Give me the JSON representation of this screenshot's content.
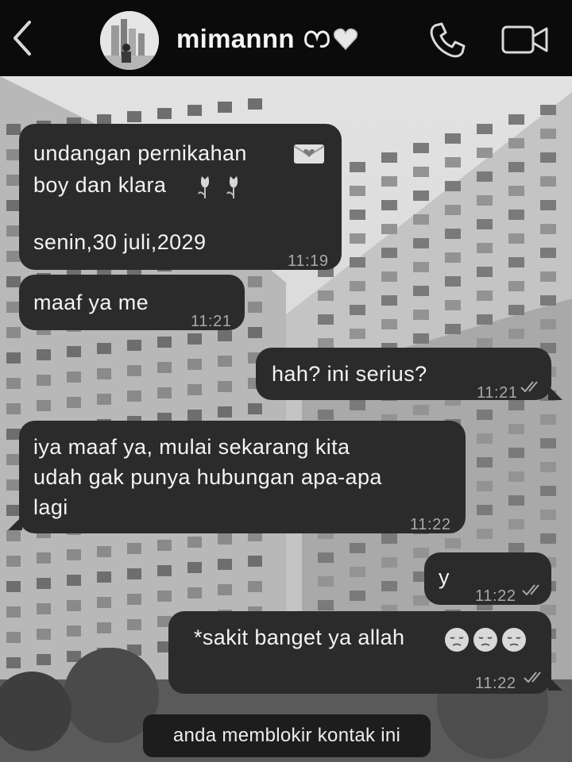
{
  "header": {
    "contact_name": "mimannn",
    "back_icon": "chevron-left-icon",
    "call_icon": "phone-icon",
    "video_icon": "video-camera-icon"
  },
  "messages": [
    {
      "direction": "incoming",
      "lines": [
        "undangan pernikahan",
        "boy dan klara",
        "",
        "senin,30 juli,2029"
      ],
      "time": "11:19"
    },
    {
      "direction": "incoming",
      "lines": [
        "maaf ya me"
      ],
      "time": "11:21"
    },
    {
      "direction": "outgoing",
      "lines": [
        "hah? ini serius?"
      ],
      "time": "11:21"
    },
    {
      "direction": "incoming",
      "lines": [
        "iya maaf ya, mulai sekarang kita",
        "udah gak punya hubungan apa-apa",
        "lagi"
      ],
      "time": "11:22"
    },
    {
      "direction": "outgoing",
      "lines": [
        "y"
      ],
      "time": "11:22"
    },
    {
      "direction": "outgoing",
      "lines": [
        "*sakit banget ya allah"
      ],
      "time": "11:22"
    }
  ],
  "system_notice": "anda memblokir kontak ini",
  "colors": {
    "header_bg": "#0b0b0b",
    "bubble_bg": "#2b2b2b",
    "time_text": "#a8a8a8"
  }
}
